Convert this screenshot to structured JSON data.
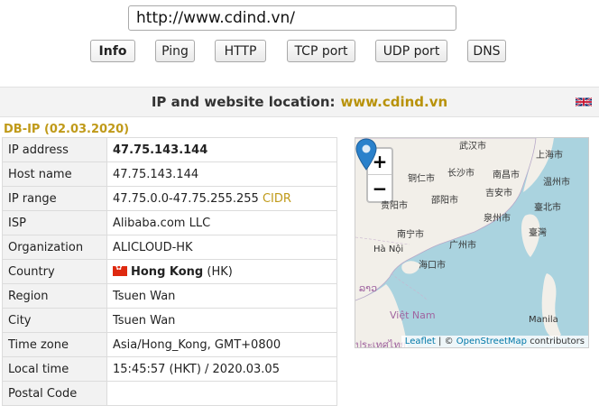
{
  "url": "http://www.cdind.vn/",
  "nav": {
    "buttons": [
      {
        "label": "Info",
        "active": true
      },
      {
        "label": "Ping",
        "active": false
      },
      {
        "label": "HTTP",
        "active": false
      },
      {
        "label": "TCP port",
        "active": false
      },
      {
        "label": "UDP port",
        "active": false
      },
      {
        "label": "DNS",
        "active": false
      }
    ]
  },
  "header": {
    "title": "IP and website location:",
    "domain": "www.cdind.vn"
  },
  "source": "DB-IP (02.03.2020)",
  "info": {
    "ip_address": {
      "key": "IP address",
      "value": "47.75.143.144"
    },
    "host_name": {
      "key": "Host name",
      "value": "47.75.143.144"
    },
    "ip_range": {
      "key": "IP range",
      "value": "47.75.0.0-47.75.255.255",
      "link": "CIDR"
    },
    "isp": {
      "key": "ISP",
      "value": "Alibaba.com LLC"
    },
    "organization": {
      "key": "Organization",
      "value": "ALICLOUD-HK"
    },
    "country": {
      "key": "Country",
      "value": "Hong Kong",
      "code": "(HK)"
    },
    "region": {
      "key": "Region",
      "value": "Tsuen Wan"
    },
    "city": {
      "key": "City",
      "value": "Tsuen Wan"
    },
    "time_zone": {
      "key": "Time zone",
      "value": "Asia/Hong_Kong, GMT+0800"
    },
    "local_time": {
      "key": "Local time",
      "value": "15:45:57 (HKT) / 2020.03.05"
    },
    "postal_code": {
      "key": "Postal Code",
      "value": ""
    }
  },
  "map": {
    "zoom_in": "+",
    "zoom_out": "−",
    "labels": {
      "wuhan": "武汉市",
      "shanghai": "上海市",
      "tongren": "铜仁市",
      "changsha": "长沙市",
      "nanchang": "南昌市",
      "wenzhou": "温州市",
      "shaoyang": "邵阳市",
      "jian": "吉安市",
      "guiyang": "贵阳市",
      "quanzhou": "泉州市",
      "taibei": "臺北市",
      "nanning": "南宁市",
      "guangzhou": "广州市",
      "taiwan": "臺灣",
      "hanoi": "Hà Nội",
      "haikou": "海口市",
      "vietnam": "Việt Nam",
      "lao": "ລາວ",
      "manila": "Manila",
      "thai": "ประเทศไทย"
    },
    "attribution": {
      "leaflet": "Leaflet",
      "sep": "| ©",
      "osm": "OpenStreetMap",
      "contributors": "contributors"
    }
  }
}
